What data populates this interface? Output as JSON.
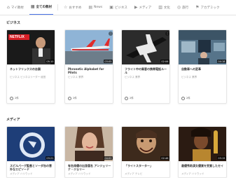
{
  "tabs": [
    {
      "icon": "home-icon",
      "glyph": "⌂",
      "label": "マイ教材"
    },
    {
      "icon": "grid-icon",
      "glyph": "▦",
      "label": "全ての教材"
    },
    {
      "icon": "star-icon",
      "glyph": "☆",
      "label": "おすすめ"
    },
    {
      "icon": "news-icon",
      "glyph": "▤",
      "label": "News"
    },
    {
      "icon": "briefcase-icon",
      "glyph": "▣",
      "label": "ビジネス"
    },
    {
      "icon": "media-icon",
      "glyph": "▶",
      "label": "メディア"
    },
    {
      "icon": "book-icon",
      "glyph": "▥",
      "label": "文化"
    },
    {
      "icon": "globe-icon",
      "glyph": "◎",
      "label": "旅行"
    },
    {
      "icon": "flag-icon",
      "glyph": "⚑",
      "label": "アカデミック"
    }
  ],
  "active_tab_index": 1,
  "sections": {
    "business": {
      "title": "ビジネス",
      "cards": [
        {
          "title": "ネットフリックスの台頭",
          "meta": "ビジネス ビジネスリーダー 経営",
          "duration": "05:10",
          "count": "2件",
          "thumb_label": "NETFLIX"
        },
        {
          "title": "Phronetic Alphabet for Pilots",
          "meta": "ビジネス 業界",
          "duration": "03:05",
          "count": "2件",
          "thumb_label": ""
        },
        {
          "title": "フライト中の乗客の携帯電話ルール",
          "meta": "ビジネス 業界",
          "duration": "02:06",
          "count": "2件",
          "thumb_label": ""
        },
        {
          "title": "自動車への変革",
          "meta": "ビジネス 業界",
          "duration": "04:18",
          "count": "2件",
          "thumb_label": ""
        }
      ]
    },
    "media": {
      "title": "メディア",
      "cards": [
        {
          "title": "スピルバーグ監督とソーダ缶の意外なエピソード",
          "meta": "メディア ハリウッド",
          "duration": "03:21",
          "count": "",
          "thumb_label": ""
        },
        {
          "title": "有名俳優の出身国名 アンジェリーナ・ジョリー",
          "meta": "メディア ハリウッド",
          "duration": "04:02",
          "count": "",
          "thumb_label": ""
        },
        {
          "title": "「ライトスターター」",
          "meta": "メディア テレビ",
          "duration": "02:46",
          "count": "",
          "thumb_label": ""
        },
        {
          "title": "最優秀助演女優賞を受賞したセイ",
          "meta": "メディア ハリウッド",
          "duration": "03:15",
          "count": "",
          "thumb_label": ""
        }
      ]
    }
  },
  "colors": {
    "accent": "#4a73e8",
    "netflix_red": "#d81f26"
  }
}
